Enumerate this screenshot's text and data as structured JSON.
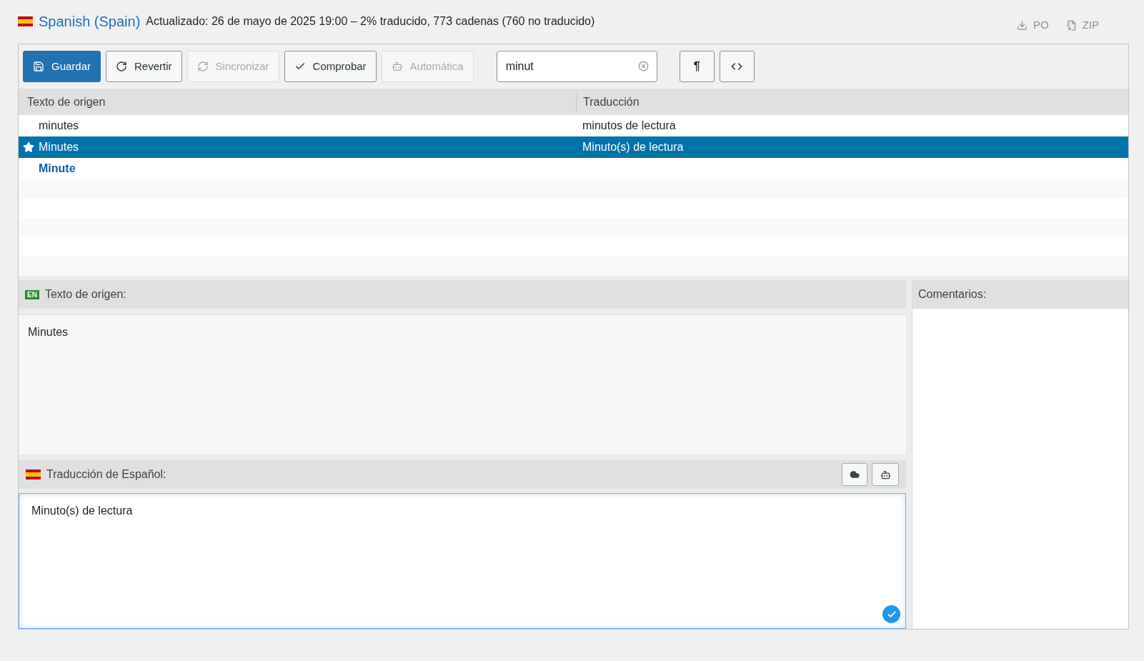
{
  "header": {
    "language": "Spanish (Spain)",
    "summary": "Actualizado: 26 de mayo de 2025 19:00 – 2% traducido, 773 cadenas (760 no traducido)",
    "downloads": [
      "PO",
      "ZIP"
    ]
  },
  "toolbar": {
    "buttons": [
      {
        "label": "Guardar",
        "kind": "primary",
        "disabled": false
      },
      {
        "label": "Revertir",
        "kind": "default",
        "disabled": false
      },
      {
        "label": "Sincronizar",
        "kind": "default",
        "disabled": true
      },
      {
        "label": "Comprobar",
        "kind": "default",
        "disabled": false
      },
      {
        "label": "Automática",
        "kind": "default",
        "disabled": true
      }
    ],
    "search": {
      "value": "minut"
    },
    "toggles": [
      {
        "kind": "text",
        "label": "¶"
      },
      {
        "kind": "code"
      }
    ]
  },
  "table": {
    "columns": [
      "Texto de origen",
      "Traducción"
    ],
    "rows": [
      {
        "source": "minutes",
        "translation": "minutos de lectura",
        "selected": false,
        "starred": false,
        "untranslated": false
      },
      {
        "source": "Minutes",
        "translation": "Minuto(s) de lectura",
        "selected": true,
        "starred": true,
        "untranslated": false
      },
      {
        "source": "Minute",
        "selected": false,
        "starred": false,
        "untranslated": true
      }
    ]
  },
  "source_panel": {
    "badge": "EN",
    "title": "Texto de origen:",
    "text": "Minutes"
  },
  "translation_panel": {
    "title": "Traducción de Español:",
    "value": "Minuto(s) de lectura",
    "valid": true
  },
  "comments_panel": {
    "title": "Comentarios:"
  }
}
